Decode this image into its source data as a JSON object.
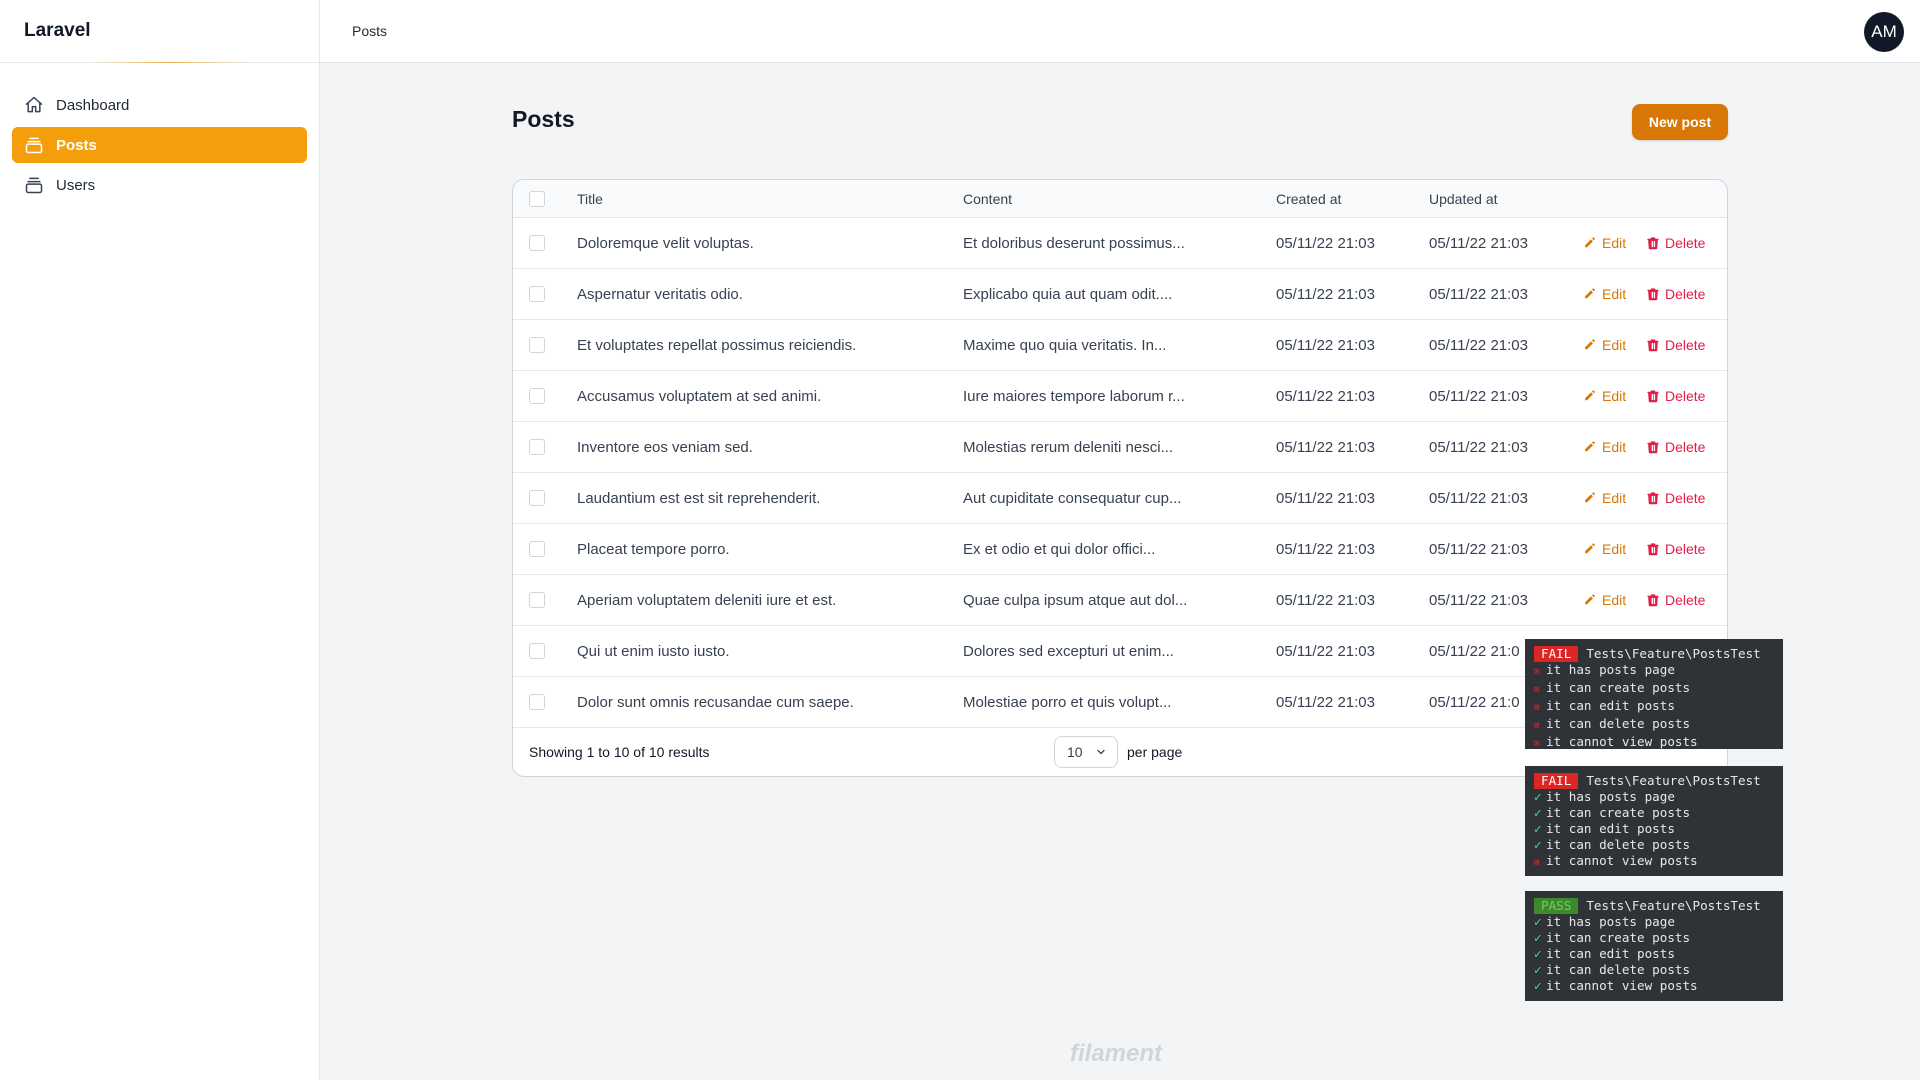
{
  "brand": "Laravel",
  "sidebar": {
    "items": [
      {
        "label": "Dashboard",
        "icon": "home-icon"
      },
      {
        "label": "Posts",
        "icon": "collection-icon",
        "active": true
      },
      {
        "label": "Users",
        "icon": "collection-icon"
      }
    ]
  },
  "topbar": {
    "breadcrumb": "Posts",
    "avatar_initials": "AM"
  },
  "page": {
    "title": "Posts",
    "new_button": "New post"
  },
  "table": {
    "columns": [
      "Title",
      "Content",
      "Created at",
      "Updated at"
    ],
    "rows": [
      {
        "title": "Doloremque velit voluptas.",
        "content": "Et doloribus deserunt possimus...",
        "created": "05/11/22 21:03",
        "updated": "05/11/22 21:03"
      },
      {
        "title": "Aspernatur veritatis odio.",
        "content": "Explicabo quia aut quam odit....",
        "created": "05/11/22 21:03",
        "updated": "05/11/22 21:03"
      },
      {
        "title": "Et voluptates repellat possimus reiciendis.",
        "content": "Maxime quo quia veritatis. In...",
        "created": "05/11/22 21:03",
        "updated": "05/11/22 21:03"
      },
      {
        "title": "Accusamus voluptatem at sed animi.",
        "content": "Iure maiores tempore laborum r...",
        "created": "05/11/22 21:03",
        "updated": "05/11/22 21:03"
      },
      {
        "title": "Inventore eos veniam sed.",
        "content": "Molestias rerum deleniti nesci...",
        "created": "05/11/22 21:03",
        "updated": "05/11/22 21:03"
      },
      {
        "title": "Laudantium est est sit reprehenderit.",
        "content": "Aut cupiditate consequatur cup...",
        "created": "05/11/22 21:03",
        "updated": "05/11/22 21:03"
      },
      {
        "title": "Placeat tempore porro.",
        "content": "Ex et odio et qui dolor offici...",
        "created": "05/11/22 21:03",
        "updated": "05/11/22 21:03"
      },
      {
        "title": "Aperiam voluptatem deleniti iure et est.",
        "content": "Quae culpa ipsum atque aut dol...",
        "created": "05/11/22 21:03",
        "updated": "05/11/22 21:03"
      },
      {
        "title": "Qui ut enim iusto iusto.",
        "content": "Dolores sed excepturi ut enim...",
        "created": "05/11/22 21:03",
        "updated": "05/11/22 21:0"
      },
      {
        "title": "Dolor sunt omnis recusandae cum saepe.",
        "content": "Molestiae porro et quis volupt...",
        "created": "05/11/22 21:03",
        "updated": "05/11/22 21:0"
      }
    ],
    "row_actions": {
      "edit": "Edit",
      "delete": "Delete"
    },
    "footer": {
      "showing": "Showing 1 to 10 of 10 results",
      "per_page_value": "10",
      "per_page_label": "per page"
    }
  },
  "terminals": [
    {
      "status": "FAIL",
      "suite": "Tests\\Feature\\PostsTest",
      "tests": [
        {
          "name": "it has posts page",
          "passed": false
        },
        {
          "name": "it can create posts",
          "passed": false
        },
        {
          "name": "it can edit posts",
          "passed": false
        },
        {
          "name": "it can delete posts",
          "passed": false
        },
        {
          "name": "it cannot view posts",
          "passed": false
        }
      ]
    },
    {
      "status": "FAIL",
      "suite": "Tests\\Feature\\PostsTest",
      "tests": [
        {
          "name": "it has posts page",
          "passed": true
        },
        {
          "name": "it can create posts",
          "passed": true
        },
        {
          "name": "it can edit posts",
          "passed": true
        },
        {
          "name": "it can delete posts",
          "passed": true
        },
        {
          "name": "it cannot view posts",
          "passed": false
        }
      ]
    },
    {
      "status": "PASS",
      "suite": "Tests\\Feature\\PostsTest",
      "tests": [
        {
          "name": "it has posts page",
          "passed": true
        },
        {
          "name": "it can create posts",
          "passed": true
        },
        {
          "name": "it can edit posts",
          "passed": true
        },
        {
          "name": "it can delete posts",
          "passed": true
        },
        {
          "name": "it cannot view posts",
          "passed": true
        }
      ]
    }
  ],
  "watermark": "filament",
  "colors": {
    "accent": "#f59e0b",
    "button": "#d97706",
    "danger": "#e11d48",
    "fail": "#dc2626",
    "pass": "#3c8a2e"
  }
}
